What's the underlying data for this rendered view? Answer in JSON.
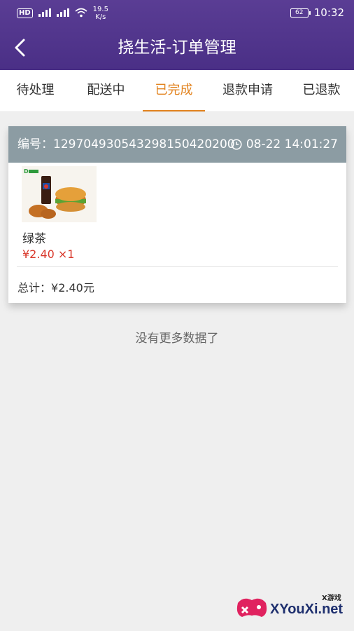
{
  "status_bar": {
    "hd": "HD",
    "sig1": "⁴⁶",
    "sig2": "⁴⁶",
    "speed_value": "19.5",
    "speed_unit": "K/s",
    "battery": "62",
    "time": "10:32"
  },
  "header": {
    "title": "挠生活-订单管理"
  },
  "tabs": [
    {
      "label": "待处理",
      "active": false
    },
    {
      "label": "配送中",
      "active": false
    },
    {
      "label": "已完成",
      "active": true
    },
    {
      "label": "退款申请",
      "active": false
    },
    {
      "label": "已退款",
      "active": false
    }
  ],
  "order": {
    "number_label": "编号：",
    "number": "1297049305432981504202​00",
    "time": "08-22 14:01:27",
    "item_name": "绿茶",
    "item_price": "¥2.40 ×1",
    "total_label": "总计：",
    "total_value": "¥2.40元"
  },
  "footer_text": "没有更多数据了",
  "watermark": {
    "brand": "XYouXi.net",
    "small": "X游戏"
  },
  "colors": {
    "header": "#4a2f86",
    "accent": "#e2831f",
    "card_header": "#8c9ca3",
    "price": "#d9382b"
  }
}
